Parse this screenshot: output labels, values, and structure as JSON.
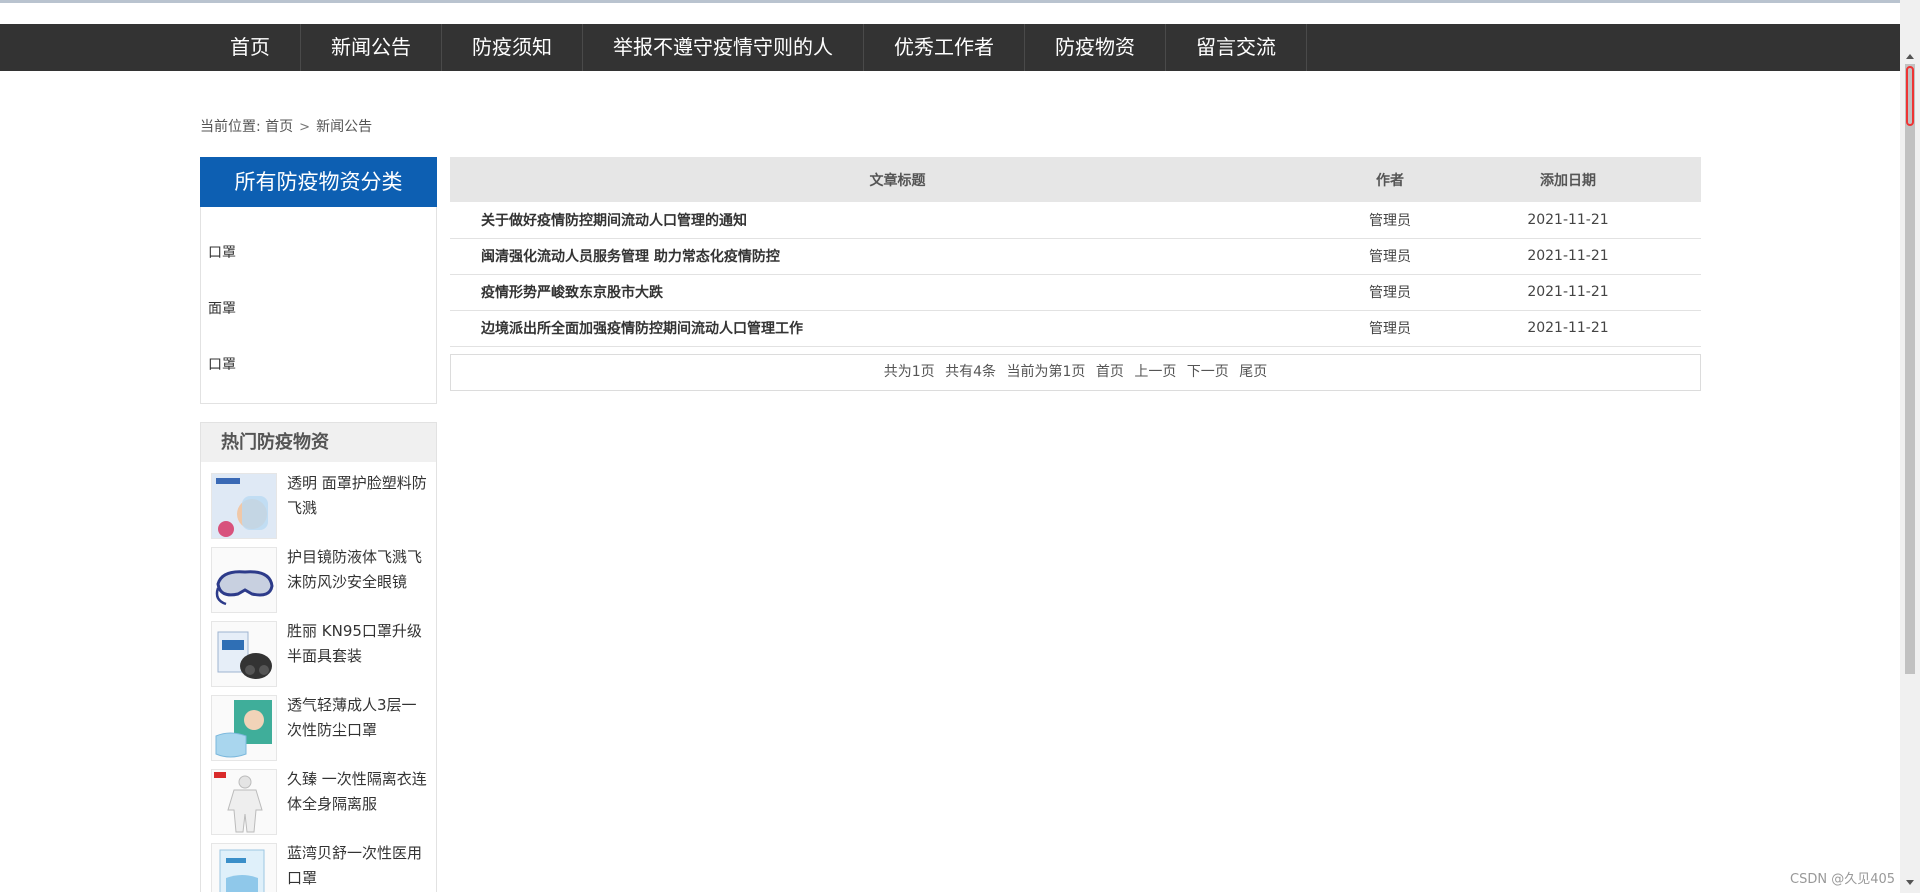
{
  "nav": {
    "items": [
      "首页",
      "新闻公告",
      "防疫须知",
      "举报不遵守疫情守则的人",
      "优秀工作者",
      "防疫物资",
      "留言交流"
    ]
  },
  "breadcrumb": {
    "prefix": "当前位置:",
    "home": "首页",
    "separator": ">",
    "current": "新闻公告"
  },
  "category": {
    "title": "所有防疫物资分类",
    "items": [
      "口罩",
      "面罩",
      "口罩"
    ]
  },
  "hot": {
    "title": "热门防疫物资",
    "items": [
      {
        "name": "透明 面罩护脸塑料防飞溅",
        "icon": "face-shield-product-image"
      },
      {
        "name": "护目镜防液体飞溅飞沫防风沙安全眼镜",
        "icon": "goggles-product-image"
      },
      {
        "name": "胜丽 KN95口罩升级半面具套装",
        "icon": "respirator-kit-product-image"
      },
      {
        "name": "透气轻薄成人3层一次性防尘口罩",
        "icon": "disposable-mask-product-image"
      },
      {
        "name": "久臻 一次性隔离衣连体全身隔离服",
        "icon": "protective-suit-product-image"
      },
      {
        "name": "蓝湾贝舒一次性医用口罩",
        "icon": "medical-mask-product-image"
      }
    ]
  },
  "table": {
    "headers": {
      "title": "文章标题",
      "author": "作者",
      "date": "添加日期"
    },
    "rows": [
      {
        "title": "关于做好疫情防控期间流动人口管理的通知",
        "author": "管理员",
        "date": "2021-11-21"
      },
      {
        "title": "闽清强化流动人员服务管理 助力常态化疫情防控",
        "author": "管理员",
        "date": "2021-11-21"
      },
      {
        "title": "疫情形势严峻致东京股市大跌",
        "author": "管理员",
        "date": "2021-11-21"
      },
      {
        "title": "边境派出所全面加强疫情防控期间流动人口管理工作",
        "author": "管理员",
        "date": "2021-11-21"
      }
    ]
  },
  "pager": {
    "total_pages": "共为1页",
    "total_items": "共有4条",
    "current": "当前为第1页",
    "first": "首页",
    "prev": "上一页",
    "next": "下一页",
    "last": "尾页"
  },
  "watermark": "CSDN @久见405",
  "colors": {
    "nav_bg": "#333333",
    "category_title_bg": "#0d5fb2",
    "table_header_bg": "#e6e6e6"
  }
}
